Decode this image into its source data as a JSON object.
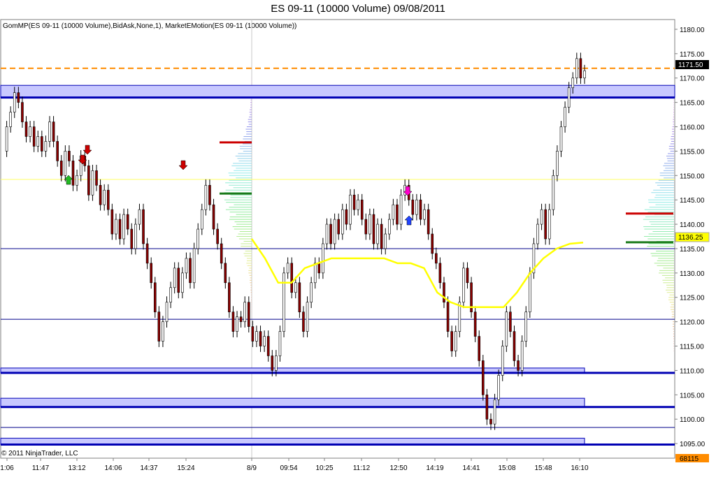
{
  "title": "ES 09-11 (10000 Volume)  09/08/2011",
  "indicator_label": "GomMP(ES 09-11 (10000 Volume),BidAsk,None,1), MarketEMotion(ES 09-11 (10000 Volume))",
  "copyright": "© 2011 NinjaTrader, LLC",
  "colors": {
    "price_up": "#ffffff",
    "price_down": "#8b0000",
    "ema_line": "#ffff00",
    "zone_line": "#0000b4",
    "zone_fill": "#c8c8ff",
    "thin_level": "#00008b",
    "orange_level": "#ff8c00",
    "red_level": "#cc0000",
    "green_level": "#1a7a1a",
    "yellow_level": "#ffff66"
  },
  "chart_data": {
    "type": "candlestick",
    "title": "ES 09-11 (10000 Volume)  09/08/2011",
    "ylim": [
      1092,
      1182
    ],
    "y_ticks": [
      1180,
      1175,
      1170,
      1165,
      1160,
      1155,
      1150,
      1145,
      1140,
      1135,
      1130,
      1125,
      1120,
      1115,
      1110,
      1105,
      1100,
      1095
    ],
    "y_tick_labels": [
      "1180.00",
      "1175.00",
      "1170.00",
      "1165.00",
      "1160.00",
      "1155.00",
      "1150.00",
      "1145.00",
      "1140.00",
      "1135.00",
      "1130.00",
      "1125.00",
      "1120.00",
      "1115.00",
      "1110.00",
      "1105.00",
      "1100.00",
      "1095.00"
    ],
    "x_tick_labels": [
      "1:06",
      "11:47",
      "13:12",
      "14:06",
      "14:37",
      "15:24",
      "8/9",
      "09:54",
      "10:25",
      "11:12",
      "12:50",
      "14:19",
      "14:41",
      "15:08",
      "15:48",
      "16:10"
    ],
    "last_price": "1171.50",
    "ema_price": "1136.25",
    "volume_box": "68115",
    "price_path": [
      1155,
      1160,
      1163,
      1167,
      1165,
      1161,
      1158,
      1160,
      1156,
      1158,
      1155,
      1157,
      1161,
      1157,
      1153,
      1150,
      1155,
      1153,
      1148,
      1150,
      1154,
      1152,
      1146,
      1151,
      1148,
      1144,
      1147,
      1143,
      1138,
      1141,
      1137,
      1142,
      1139,
      1135,
      1140,
      1143,
      1136,
      1132,
      1128,
      1122,
      1116,
      1120,
      1124,
      1127,
      1131,
      1126,
      1130,
      1133,
      1128,
      1135,
      1139,
      1143,
      1148,
      1144,
      1139,
      1136,
      1132,
      1128,
      1122,
      1118,
      1121,
      1120,
      1124,
      1119,
      1116,
      1118,
      1115,
      1117,
      1113,
      1110,
      1113,
      1118,
      1130,
      1132,
      1126,
      1128,
      1122,
      1118,
      1124,
      1128,
      1132,
      1130,
      1136,
      1140,
      1136,
      1141,
      1138,
      1143,
      1140,
      1146,
      1143,
      1145,
      1141,
      1138,
      1142,
      1136,
      1140,
      1135,
      1138,
      1141,
      1144,
      1140,
      1146,
      1148,
      1145,
      1142,
      1145,
      1141,
      1143,
      1138,
      1134,
      1132,
      1128,
      1124,
      1118,
      1114,
      1118,
      1124,
      1131,
      1128,
      1122,
      1117,
      1112,
      1105,
      1100,
      1099,
      1104,
      1109,
      1115,
      1122,
      1118,
      1112,
      1110,
      1116,
      1122,
      1130,
      1136,
      1140,
      1143,
      1137,
      1143,
      1150,
      1155,
      1160,
      1164,
      1168,
      1170,
      1174,
      1170,
      1171.5
    ],
    "ema_path": [
      1137,
      1133,
      1128,
      1128,
      1131,
      1132,
      1133,
      1133,
      1133,
      1133,
      1133,
      1132,
      1132,
      1131,
      1126,
      1124,
      1123,
      1123,
      1123,
      1123,
      1126,
      1130,
      1133,
      1135,
      1136,
      1136.25
    ],
    "levels": [
      {
        "price": 1172.0,
        "style": "orange-dashed"
      },
      {
        "price": 1149.2,
        "style": "yellow-thin"
      },
      {
        "price": 1135.0,
        "style": "blue-thin"
      },
      {
        "price": 1120.5,
        "style": "blue-thin"
      },
      {
        "price": 1098.3,
        "style": "blue-thin"
      }
    ],
    "zones": [
      {
        "top": 1168.5,
        "bottom": 1166.0,
        "extends": "full"
      },
      {
        "top": 1110.5,
        "bottom": 1109.5,
        "extends": "partial"
      },
      {
        "top": 1104.3,
        "bottom": 1102.5,
        "extends": "partial"
      },
      {
        "top": 1096.1,
        "bottom": 1094.8,
        "extends": "partial"
      }
    ],
    "grid": false,
    "legend": "none"
  }
}
